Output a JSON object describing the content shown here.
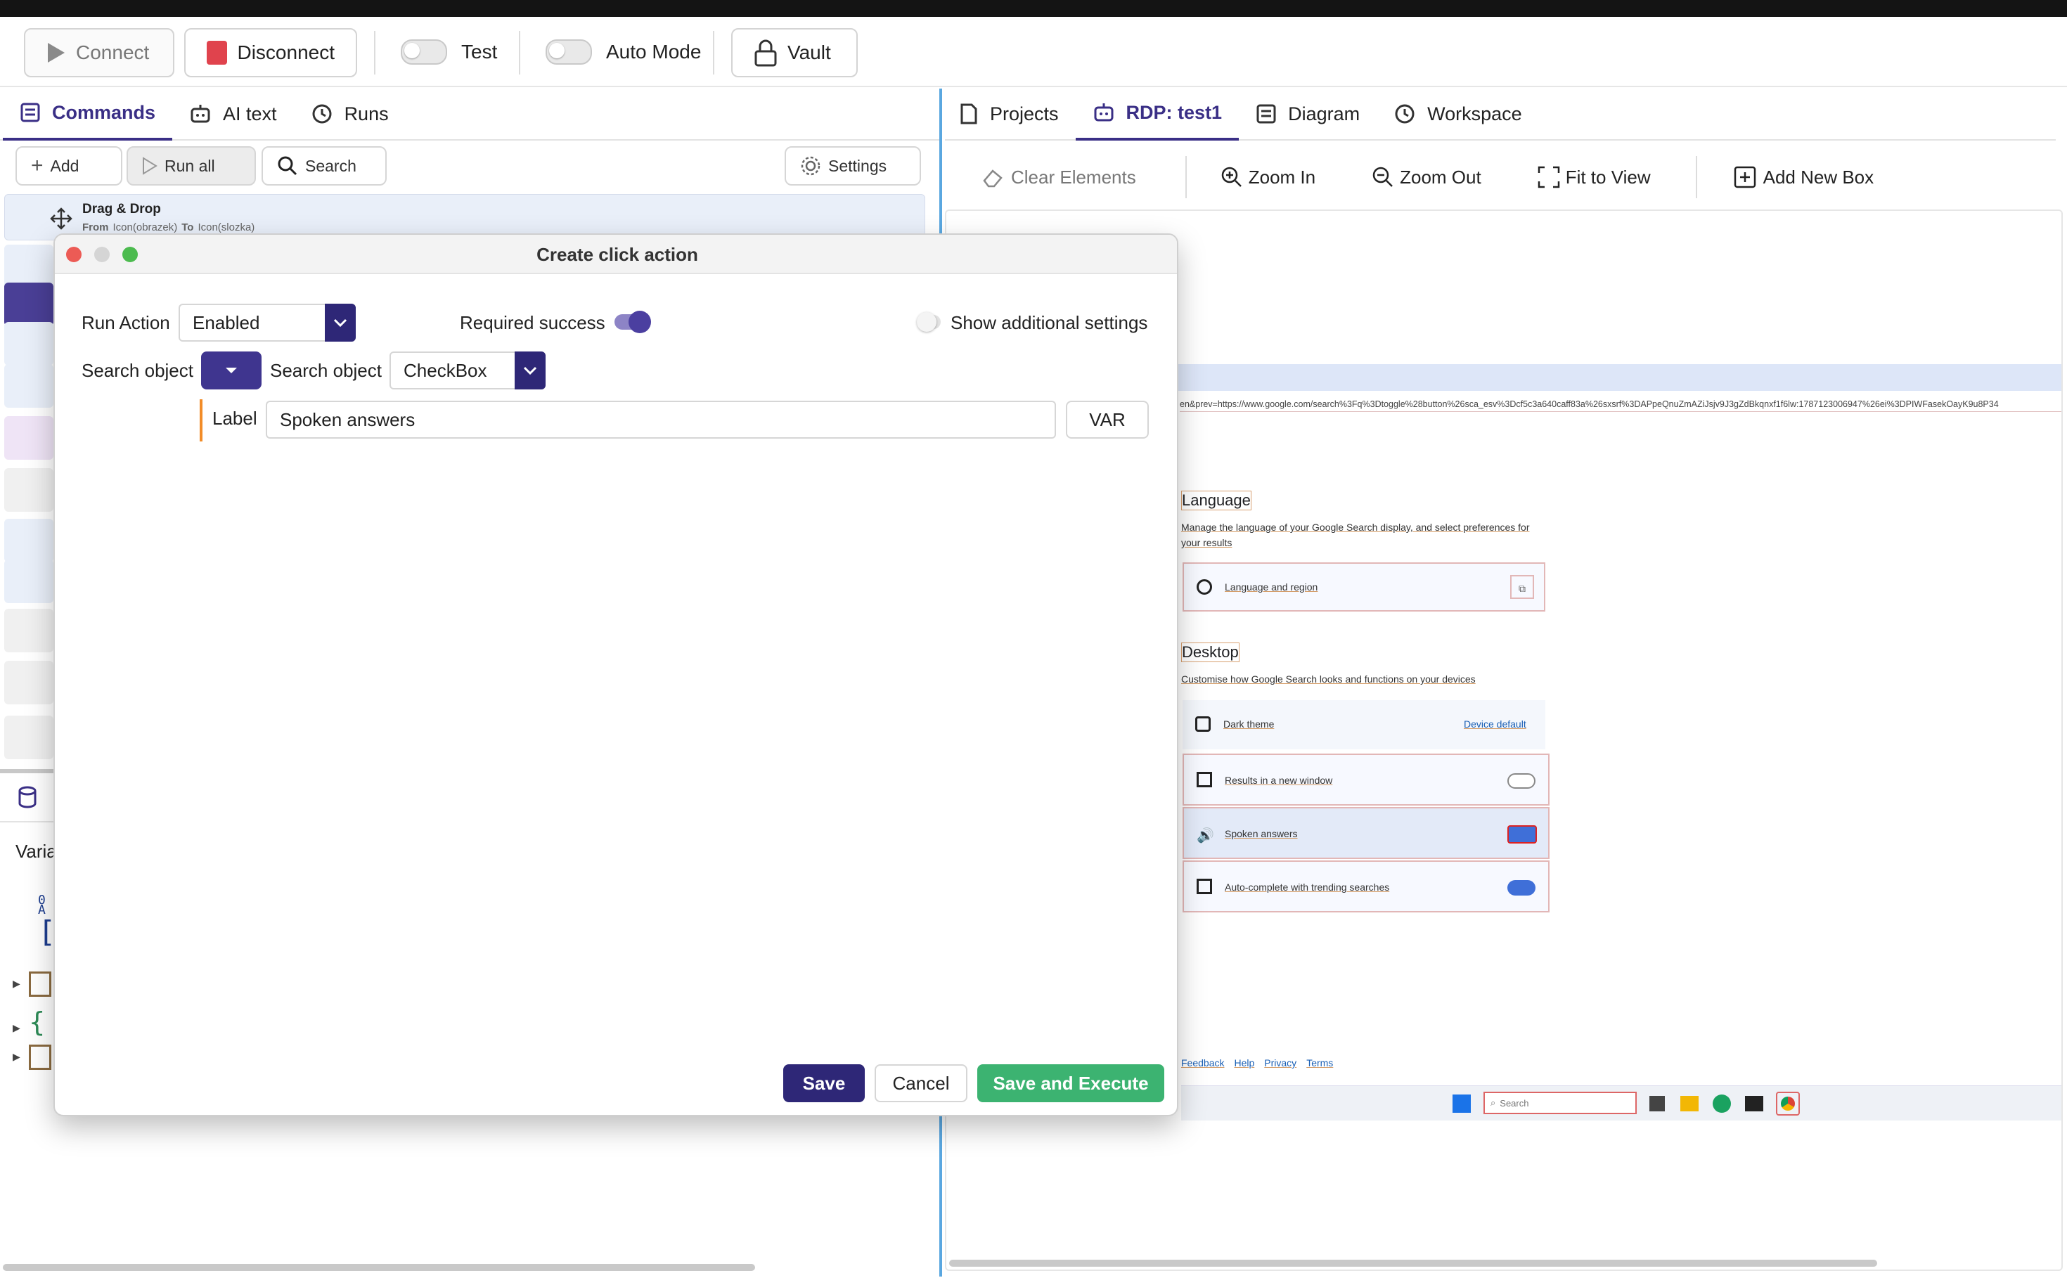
{
  "toolbar": {
    "connect": "Connect",
    "disconnect": "Disconnect",
    "test": "Test",
    "auto_mode": "Auto Mode",
    "vault": "Vault"
  },
  "left_tabs": [
    "Commands",
    "AI text",
    "Runs"
  ],
  "commands_toolbar": {
    "add": "Add",
    "run_all": "Run all",
    "search": "Search",
    "settings": "Settings"
  },
  "first_command": {
    "title": "Drag & Drop",
    "detail_from": "From",
    "detail_from_val": "Icon(obrazek)",
    "detail_to": "To",
    "detail_to_val": "Icon(slozka)"
  },
  "vars_panel": {
    "label": "Varia",
    "code": [
      "0",
      "A",
      "["
    ]
  },
  "right_tabs": [
    "Projects",
    "RDP: test1",
    "Diagram",
    "Workspace"
  ],
  "canvas_toolbar": {
    "clear": "Clear Elements",
    "zoom_in": "Zoom In",
    "zoom_out": "Zoom Out",
    "fit": "Fit to View",
    "add_box": "Add New Box"
  },
  "canvas": {
    "url": "en&prev=https://www.google.com/search%3Fq%3Dtoggle%28button%26sca_esv%3Dcf5c3a640caff83a%26sxsrf%3DAPpeQnuZmAZiJsjv9J3gZdBkqnxf1f6lw:1787123006947%26ei%3DPIWFasekOayK9u8P34",
    "language_heading": "Language",
    "language_desc_1": "Manage the language of your Google Search display, and select preferences for",
    "language_desc_2": "your results",
    "language_row": "Language and region",
    "desktop_heading": "Desktop",
    "desktop_desc": "Customise how Google Search looks and functions on your devices",
    "dark_theme": "Dark theme",
    "dark_theme_value": "Device default",
    "results_new_window": "Results in a new window",
    "spoken_answers": "Spoken answers",
    "autocomplete": "Auto-complete with trending searches",
    "footer_links": [
      "Feedback",
      "Help",
      "Privacy",
      "Terms"
    ],
    "taskbar_search": "Search"
  },
  "modal": {
    "title": "Create click action",
    "run_action_label": "Run Action",
    "run_action_value": "Enabled",
    "required_success": "Required success",
    "show_additional": "Show additional settings",
    "search_object_label": "Search object",
    "search_object_label2": "Search object",
    "search_object_value": "CheckBox",
    "label_label": "Label",
    "label_value": "Spoken answers",
    "var_button": "VAR",
    "save": "Save",
    "cancel": "Cancel",
    "save_execute": "Save and Execute"
  },
  "colors": {
    "accent": "#2e2777",
    "toggle_on": "#4b3fa0",
    "save_execute": "#3cb371",
    "disconnect_icon": "#e0434d",
    "divider": "#5aa7e0"
  }
}
